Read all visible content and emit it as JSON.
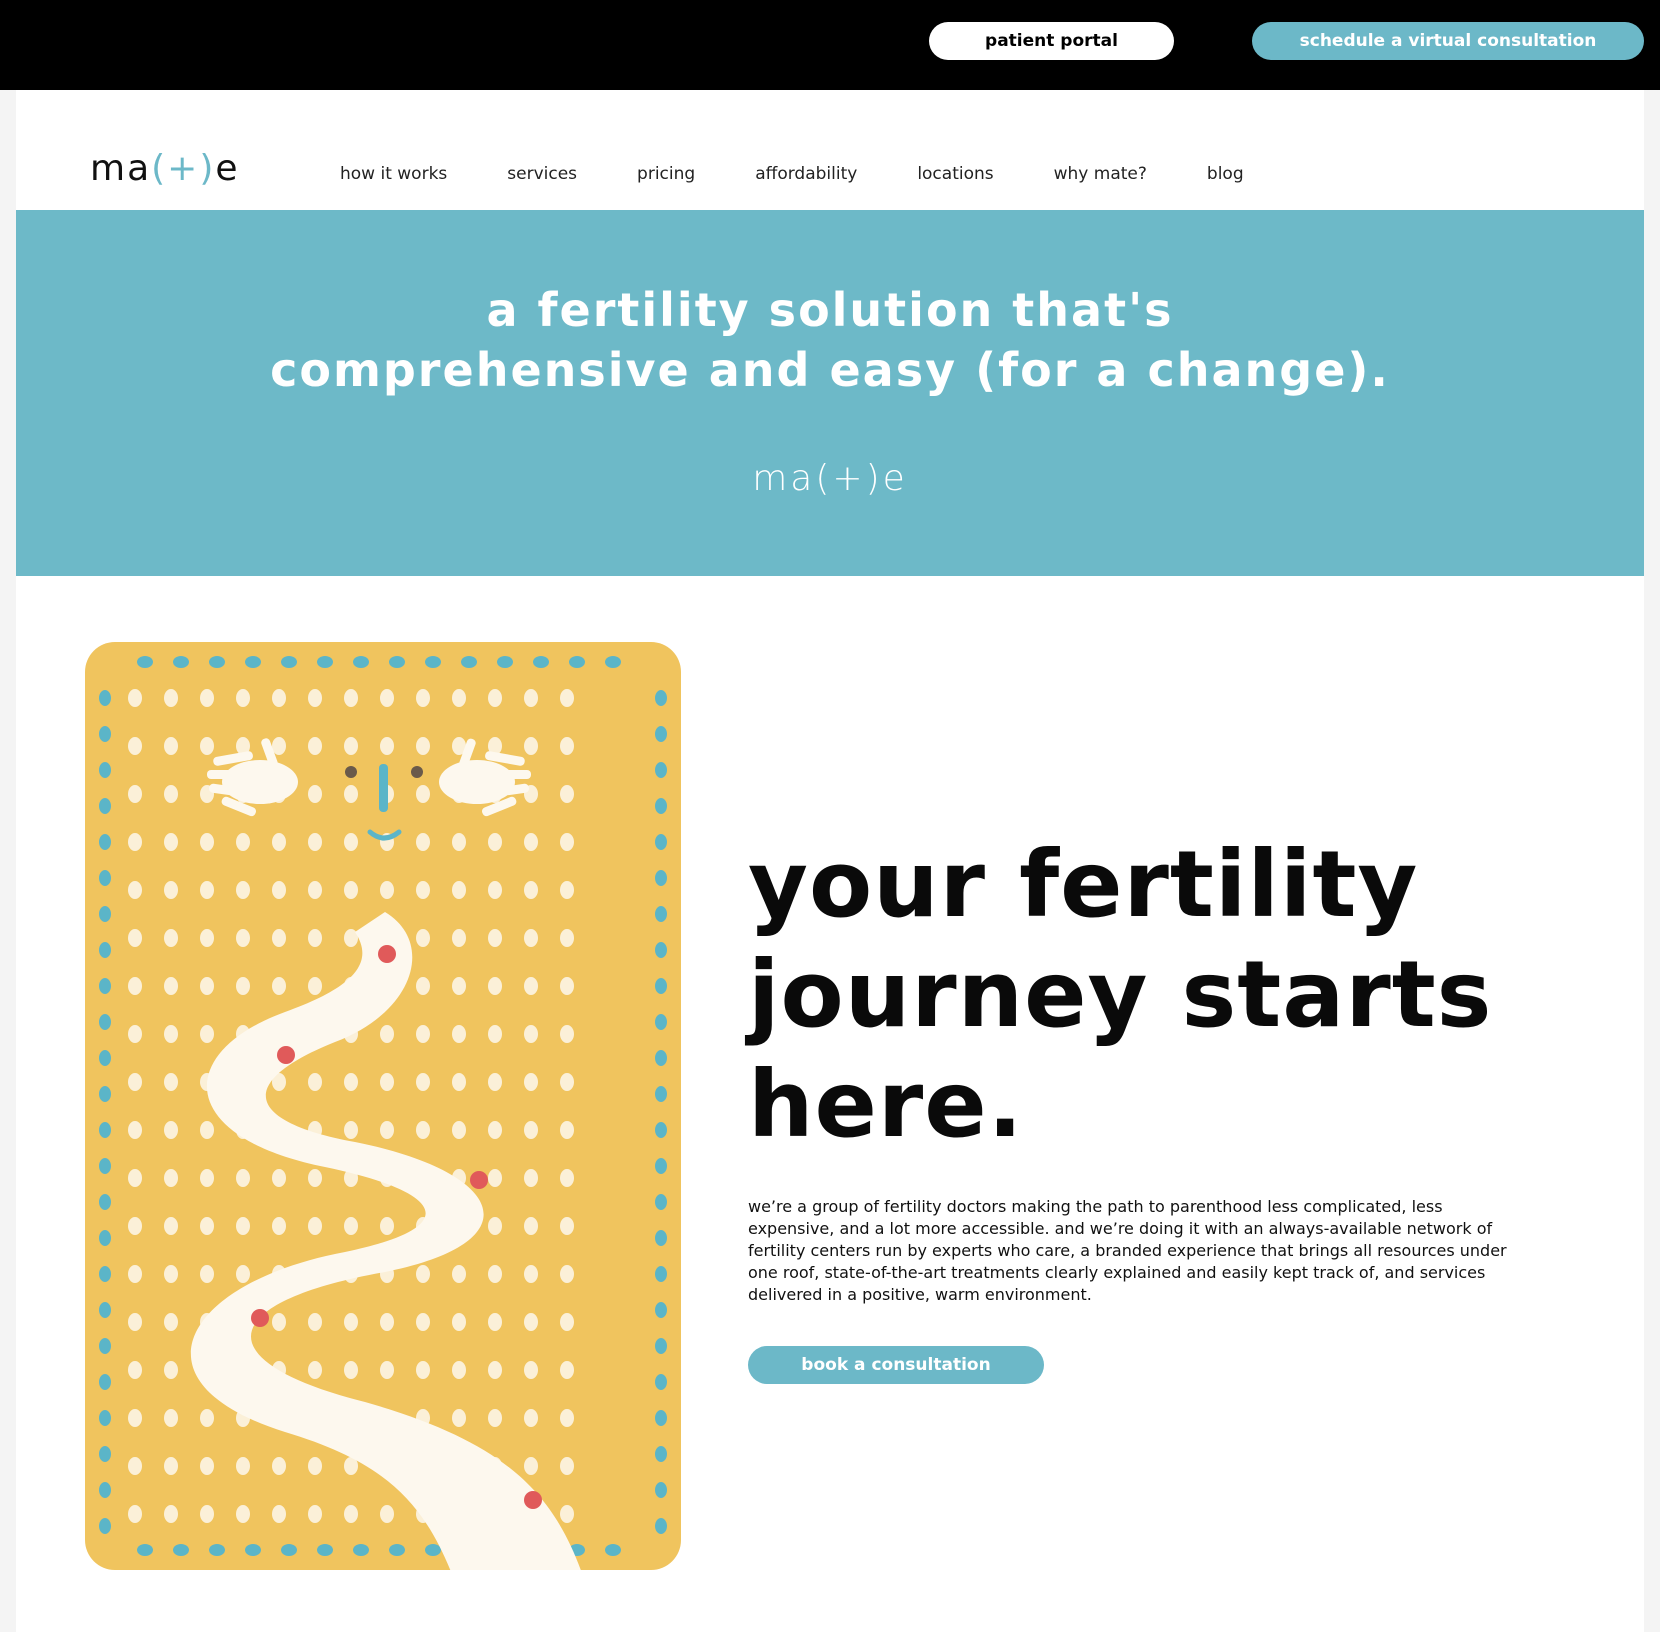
{
  "topbar": {
    "portal_label": "patient portal",
    "schedule_label": "schedule a virtual consultation"
  },
  "header": {
    "logo": {
      "pre": "ma",
      "plus": "(+)",
      "post": "e"
    },
    "nav": [
      "how it works",
      "services",
      "pricing",
      "affordability",
      "locations",
      "why mate?",
      "blog"
    ]
  },
  "hero": {
    "title_line1": "a fertility solution that's",
    "title_line2": "comprehensive and easy (for a change).",
    "logo": "ma(+)e"
  },
  "main": {
    "heading_line1": "your fertility",
    "heading_line2": "journey starts",
    "heading_line3": "here.",
    "body": "we’re a group of fertility doctors making the path to parenthood less complicated, less expensive, and a lot more accessible. and we’re doing it with an always-available network of fertility centers run by experts who care, a branded experience that brings all resources under one roof, state-of-the-art treatments clearly explained and easily kept track of, and services delivered in a positive, warm environment.",
    "cta_label": "book a consultation"
  },
  "colors": {
    "accent": "#6cb8c8",
    "topbar": "#000000",
    "illustration_bg": "#f0c45e",
    "path": "#fdf8ee",
    "dots": "#fbf0d8",
    "border_dots": "#5bb5c8",
    "markers": "#e05a5a"
  }
}
